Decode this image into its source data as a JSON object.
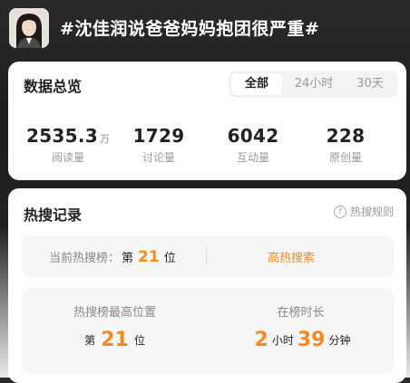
{
  "header": {
    "title": "#沈佳润说爸爸妈妈抱团很严重#"
  },
  "overview": {
    "title": "数据总览",
    "tabs": [
      {
        "label": "全部",
        "active": true
      },
      {
        "label": "24小时",
        "active": false
      },
      {
        "label": "30天",
        "active": false
      }
    ],
    "stats": [
      {
        "value": "2535.3",
        "unit": "万",
        "label": "阅读量"
      },
      {
        "value": "1729",
        "unit": "",
        "label": "讨论量"
      },
      {
        "value": "6042",
        "unit": "",
        "label": "互动量"
      },
      {
        "value": "228",
        "unit": "",
        "label": "原创量"
      }
    ]
  },
  "hot": {
    "title": "热搜记录",
    "rules_label": "热搜规则",
    "current": {
      "label": "当前热搜榜：",
      "prefix": "第",
      "rank": "21",
      "suffix": "位",
      "tag": "高热搜索"
    },
    "peak": {
      "label": "热搜榜最高位置",
      "prefix": "第",
      "rank": "21",
      "suffix": "位"
    },
    "duration": {
      "label": "在榜时长",
      "hours": "2",
      "hours_unit": "小时",
      "minutes": "39",
      "minutes_unit": "分钟"
    }
  },
  "colors": {
    "accent": "#f7891e",
    "card_bg": "#ffffff",
    "box_bg": "#f6f6f6"
  }
}
